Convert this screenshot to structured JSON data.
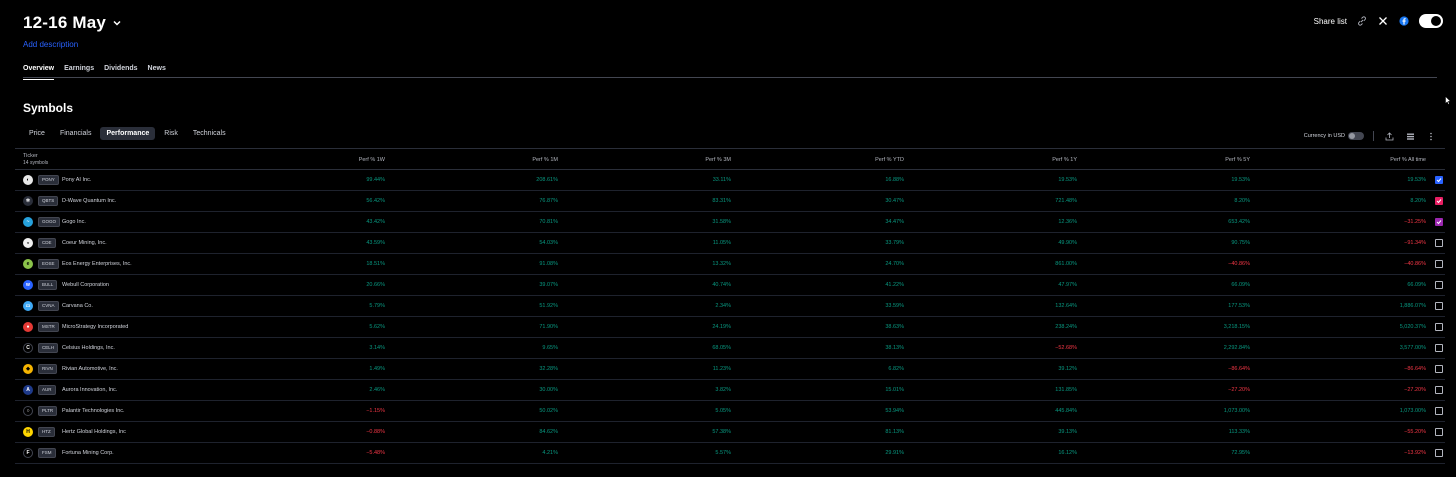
{
  "header": {
    "title": "12-16 May",
    "add_description": "Add description",
    "share_label": "Share list"
  },
  "main_tabs": [
    {
      "label": "Overview",
      "active": true
    },
    {
      "label": "Earnings",
      "active": false
    },
    {
      "label": "Dividends",
      "active": false
    },
    {
      "label": "News",
      "active": false
    }
  ],
  "section": {
    "title": "Symbols",
    "sub_tabs": [
      {
        "label": "Price",
        "active": false
      },
      {
        "label": "Financials",
        "active": false
      },
      {
        "label": "Performance",
        "active": true
      },
      {
        "label": "Risk",
        "active": false
      },
      {
        "label": "Technicals",
        "active": false
      }
    ],
    "currency_label": "Currency in USD",
    "currency_toggle": false
  },
  "table": {
    "ticker_header": "Ticker",
    "count": "14 symbols",
    "columns": [
      "Perf % 1W",
      "Perf % 1M",
      "Perf % 3M",
      "Perf % YTD",
      "Perf % 1Y",
      "Perf % 5Y",
      "Perf % All time"
    ],
    "rows": [
      {
        "symbol": "PONY",
        "name": "Pony AI Inc.",
        "logo_color": "#e8e8e8",
        "logo_glyph": "◐",
        "values": [
          "99.44%",
          "208.61%",
          "33.11%",
          "16.88%",
          "19.53%",
          "19.53%",
          "19.53%"
        ],
        "checked": true,
        "check_color": "#2962ff"
      },
      {
        "symbol": "QBTS",
        "name": "D-Wave Quantum Inc.",
        "logo_color": "#2a2e39",
        "logo_glyph": "✲",
        "values": [
          "56.42%",
          "76.87%",
          "83.31%",
          "30.47%",
          "721.48%",
          "8.20%",
          "8.20%"
        ],
        "checked": true,
        "check_color": "#e91e63"
      },
      {
        "symbol": "GOGO",
        "name": "Gogo Inc.",
        "logo_color": "#26a1dc",
        "logo_glyph": "~",
        "values": [
          "43.42%",
          "70.81%",
          "31.58%",
          "34.47%",
          "12.36%",
          "653.42%",
          "−31.25%"
        ],
        "checked": true,
        "check_color": "#9c27b0"
      },
      {
        "symbol": "CDE",
        "name": "Coeur Mining, Inc.",
        "logo_color": "#f0f0f0",
        "logo_glyph": "◒",
        "values": [
          "43.59%",
          "54.03%",
          "11.05%",
          "33.79%",
          "49.90%",
          "90.75%",
          "−91.34%"
        ],
        "checked": false,
        "check_color": ""
      },
      {
        "symbol": "EOSE",
        "name": "Eos Energy Enterprises, Inc.",
        "logo_color": "#8bc34a",
        "logo_glyph": "e",
        "values": [
          "18.51%",
          "91.08%",
          "13.32%",
          "24.70%",
          "861.00%",
          "−40.86%",
          "−40.86%"
        ],
        "checked": false,
        "check_color": ""
      },
      {
        "symbol": "BULL",
        "name": "Webull Corporation",
        "logo_color": "#2962ff",
        "logo_glyph": "w",
        "values": [
          "20.66%",
          "39.07%",
          "40.74%",
          "41.22%",
          "47.97%",
          "66.09%",
          "66.09%"
        ],
        "checked": false,
        "check_color": ""
      },
      {
        "symbol": "CVNA",
        "name": "Carvana Co.",
        "logo_color": "#3fa9f5",
        "logo_glyph": "▭",
        "values": [
          "5.79%",
          "51.92%",
          "2.34%",
          "33.59%",
          "132.64%",
          "177.53%",
          "1,886.07%"
        ],
        "checked": false,
        "check_color": ""
      },
      {
        "symbol": "MSTR",
        "name": "MicroStrategy Incorporated",
        "logo_color": "#e53935",
        "logo_glyph": "●",
        "values": [
          "5.62%",
          "71.90%",
          "24.19%",
          "38.63%",
          "238.24%",
          "3,218.15%",
          "5,020.37%"
        ],
        "checked": false,
        "check_color": ""
      },
      {
        "symbol": "CELH",
        "name": "Celsius Holdings, Inc.",
        "logo_color": "#000000",
        "logo_glyph": "C",
        "values": [
          "3.14%",
          "9.65%",
          "68.05%",
          "38.13%",
          "−52.68%",
          "2,292.84%",
          "3,577.00%"
        ],
        "checked": false,
        "check_color": ""
      },
      {
        "symbol": "RIVN",
        "name": "Rivian Automotive, Inc.",
        "logo_color": "#f5b400",
        "logo_glyph": "◆",
        "values": [
          "1.49%",
          "32.28%",
          "11.23%",
          "6.82%",
          "39.12%",
          "−86.64%",
          "−86.64%"
        ],
        "checked": false,
        "check_color": ""
      },
      {
        "symbol": "AUR",
        "name": "Aurora Innovation, Inc.",
        "logo_color": "#1e3a8a",
        "logo_glyph": "A",
        "values": [
          "2.46%",
          "30.00%",
          "3.82%",
          "15.01%",
          "131.85%",
          "−27.20%",
          "−27.20%"
        ],
        "checked": false,
        "check_color": ""
      },
      {
        "symbol": "PLTR",
        "name": "Palantir Technologies Inc.",
        "logo_color": "#000000",
        "logo_glyph": "○",
        "values": [
          "−1.15%",
          "50.02%",
          "5.05%",
          "53.94%",
          "445.84%",
          "1,073.00%",
          "1,073.00%"
        ],
        "checked": false,
        "check_color": ""
      },
      {
        "symbol": "HTZ",
        "name": "Hertz Global Holdings, Inc",
        "logo_color": "#ffd600",
        "logo_glyph": "H",
        "values": [
          "−0.88%",
          "84.62%",
          "57.38%",
          "81.13%",
          "39.13%",
          "113.33%",
          "−55.20%"
        ],
        "checked": false,
        "check_color": ""
      },
      {
        "symbol": "FSM",
        "name": "Fortuna Mining Corp.",
        "logo_color": "#000000",
        "logo_glyph": "F",
        "values": [
          "−5.48%",
          "4.21%",
          "5.57%",
          "29.91%",
          "16.12%",
          "72.95%",
          "−13.92%"
        ],
        "checked": false,
        "check_color": ""
      }
    ]
  }
}
